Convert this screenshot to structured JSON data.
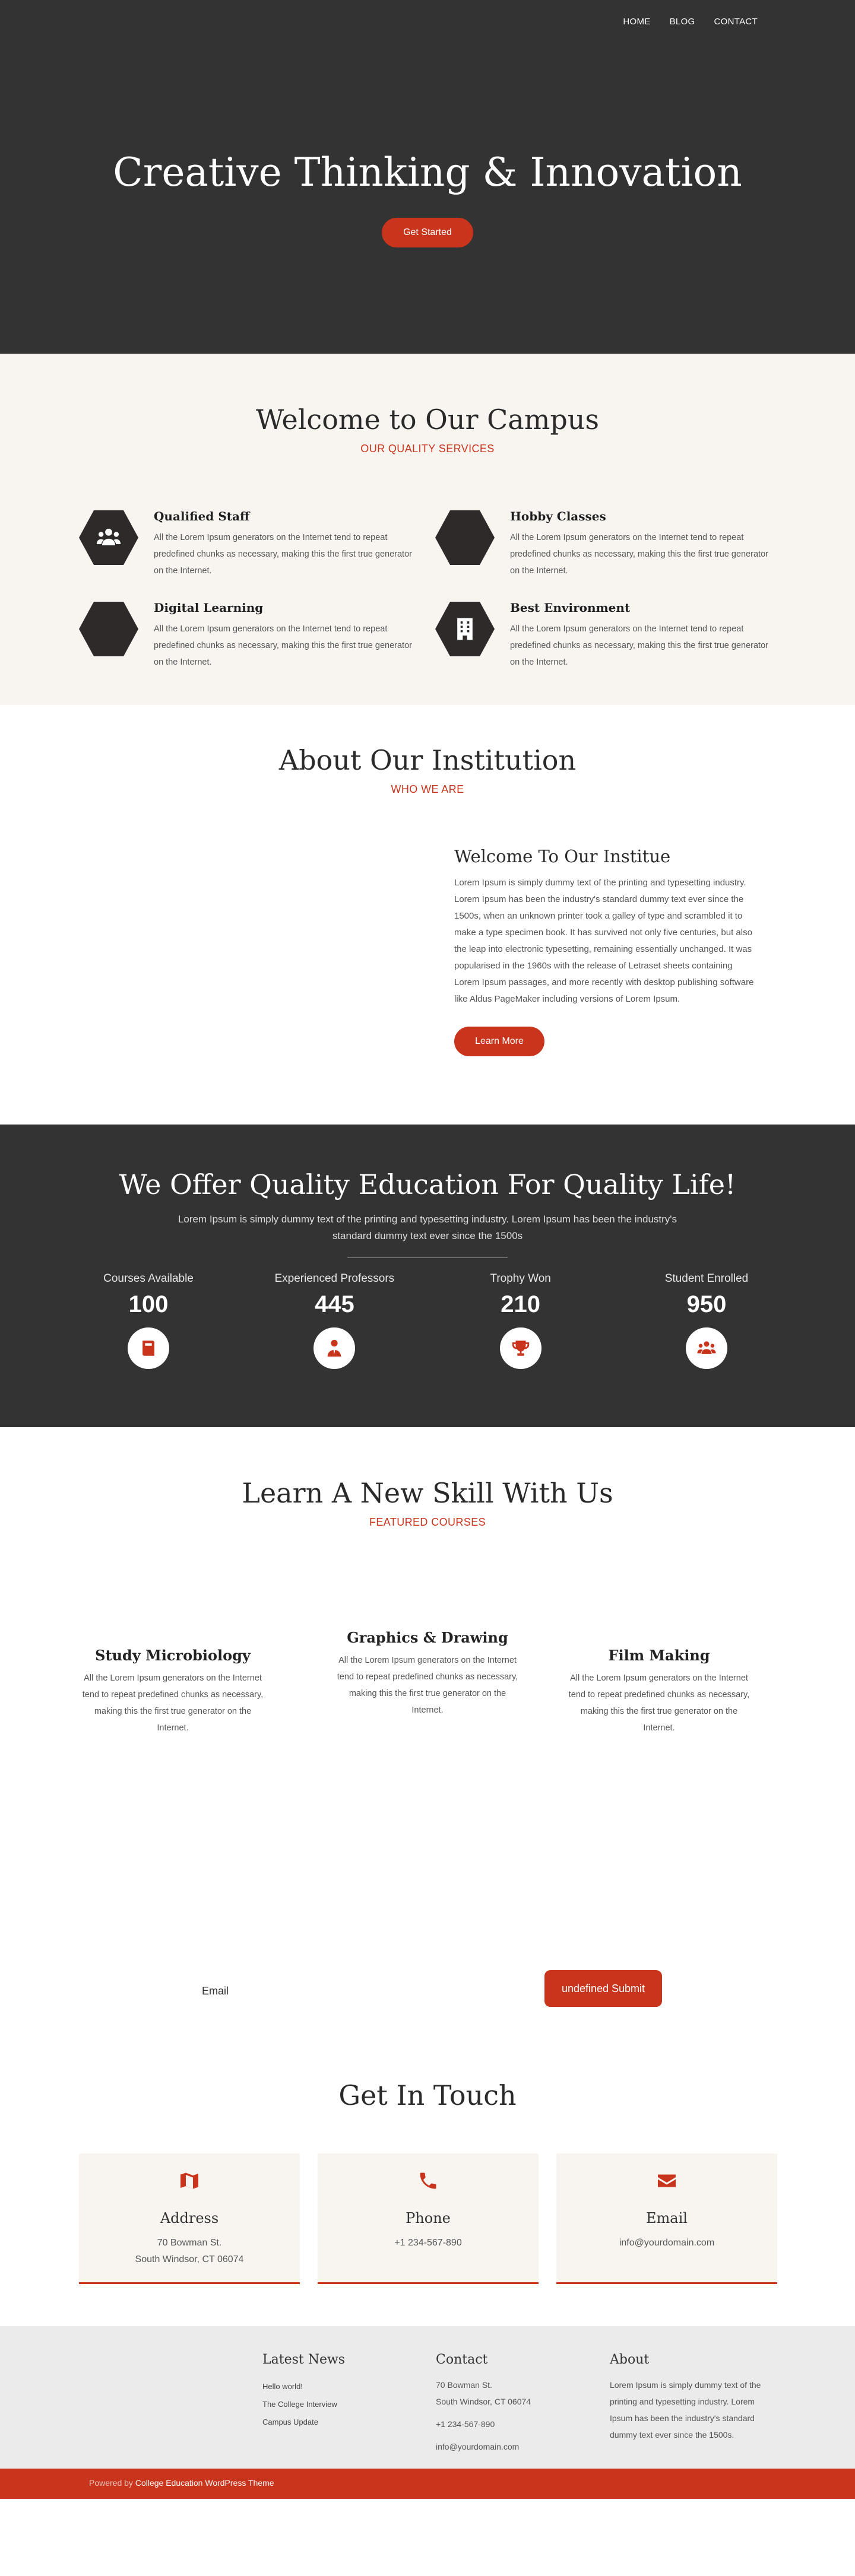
{
  "nav": {
    "items": [
      "HOME",
      "BLOG",
      "CONTACT"
    ]
  },
  "hero": {
    "title": "Creative Thinking & Innovation",
    "button": "Get Started"
  },
  "campus": {
    "title": "Welcome to Our Campus",
    "subtitle": "OUR QUALITY SERVICES",
    "features": [
      {
        "title": "Qualified Staff",
        "text": "All the Lorem Ipsum generators on the Internet tend to repeat predefined chunks as necessary, making this the first true generator on the Internet.",
        "icon": "users-icon"
      },
      {
        "title": "Hobby Classes",
        "text": "All the Lorem Ipsum generators on the Internet tend to repeat predefined chunks as necessary, making this the first true generator on the Internet.",
        "icon": "palette-icon"
      },
      {
        "title": "Digital Learning",
        "text": "All the Lorem Ipsum generators on the Internet tend to repeat predefined chunks as necessary, making this the first true generator on the Internet.",
        "icon": "laptop-icon"
      },
      {
        "title": "Best Environment",
        "text": "All the Lorem Ipsum generators on the Internet tend to repeat predefined chunks as necessary, making this the first true generator on the Internet.",
        "icon": "building-icon"
      }
    ]
  },
  "about": {
    "title": "About Our Institution",
    "subtitle": "WHO WE ARE",
    "heading": "Welcome To Our Institue",
    "text": "Lorem Ipsum is simply dummy text of the printing and typesetting industry. Lorem Ipsum has been the industry's standard dummy text ever since the 1500s, when an unknown printer took a galley of type and scrambled it to make a type specimen book. It has survived not only five centuries, but also the leap into electronic typesetting, remaining essentially unchanged. It was popularised in the 1960s with the release of Letraset sheets containing Lorem Ipsum passages, and more recently with desktop publishing software like Aldus PageMaker including versions of Lorem Ipsum.",
    "button": "Learn More"
  },
  "stats": {
    "title": "We Offer Quality Education For Quality Life!",
    "text": "Lorem Ipsum is simply dummy text of the printing and typesetting industry. Lorem Ipsum has been the industry's standard dummy text ever since the 1500s",
    "counters": [
      {
        "label": "Courses Available",
        "value": "100",
        "icon": "book-icon"
      },
      {
        "label": "Experienced Professors",
        "value": "445",
        "icon": "professor-icon"
      },
      {
        "label": "Trophy Won",
        "value": "210",
        "icon": "trophy-icon"
      },
      {
        "label": "Student Enrolled",
        "value": "950",
        "icon": "students-icon"
      }
    ]
  },
  "skills": {
    "title": "Learn A New Skill With Us",
    "subtitle": "FEATURED COURSES",
    "courses": [
      {
        "title": "Study Microbiology",
        "text": "All the Lorem Ipsum generators on the Internet tend to repeat predefined chunks as necessary, making this the first true generator on the Internet."
      },
      {
        "title": "Graphics & Drawing",
        "text": "All the Lorem Ipsum generators on the Internet tend to repeat predefined chunks as necessary, making this the first true generator on the Internet."
      },
      {
        "title": "Film Making",
        "text": "All the Lorem Ipsum generators on the Internet tend to repeat predefined chunks as necessary, making this the first true generator on the Internet."
      }
    ]
  },
  "newsletter": {
    "email_label": "Email",
    "submit": "undefined  Submit"
  },
  "contact": {
    "title": "Get In Touch",
    "cards": [
      {
        "title": "Address",
        "line1": "70 Bowman St.",
        "line2": "South Windsor, CT 06074",
        "icon": "map-icon"
      },
      {
        "title": "Phone",
        "line1": "+1 234-567-890",
        "line2": "",
        "icon": "phone-icon"
      },
      {
        "title": "Email",
        "line1": "info@yourdomain.com",
        "line2": "",
        "icon": "envelope-icon"
      }
    ]
  },
  "footer": {
    "news": {
      "title": "Latest News",
      "items": [
        "Hello world!",
        "The College Interview",
        "Campus Update"
      ]
    },
    "contact": {
      "title": "Contact",
      "address1": "70 Bowman St.",
      "address2": "South Windsor, CT 06074",
      "phone": "+1 234-567-890",
      "email": "info@yourdomain.com"
    },
    "about": {
      "title": "About",
      "text": "Lorem Ipsum is simply dummy text of the printing and typesetting industry. Lorem Ipsum has been the industry's standard dummy text ever since the 1500s."
    },
    "credit_prefix": "Powered by",
    "credit_link": "College Education WordPress Theme"
  },
  "colors": {
    "accent": "#c9341d",
    "dark": "#333333",
    "cream": "#f8f5f1",
    "footer": "#ebebeb"
  }
}
